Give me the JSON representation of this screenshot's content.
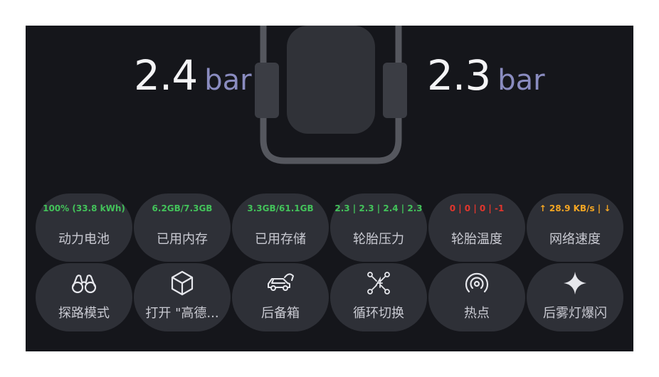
{
  "tire_pressure": {
    "front_left": {
      "value": "2.4",
      "unit": "bar"
    },
    "front_right": {
      "value": "2.3",
      "unit": "bar"
    }
  },
  "status_tiles": [
    {
      "value": "100% (33.8 kWh)",
      "label": "动力电池",
      "color": "#43c25a"
    },
    {
      "value": "6.2GB/7.3GB",
      "label": "已用内存",
      "color": "#43c25a"
    },
    {
      "value": "3.3GB/61.1GB",
      "label": "已用存储",
      "color": "#43c25a"
    },
    {
      "value": "2.3 | 2.3 | 2.4 | 2.3",
      "label": "轮胎压力",
      "color": "#43c25a"
    },
    {
      "value": "0 | 0 | 0 | -1",
      "label": "轮胎温度",
      "color": "#e2362d"
    },
    {
      "value": "↑ 28.9 KB/s | ↓",
      "label": "网络速度",
      "color": "#f5a623"
    }
  ],
  "action_tiles": [
    {
      "label": "探路模式",
      "icon": "binoculars-icon"
    },
    {
      "label": "打开 \"高德...",
      "icon": "cube-icon"
    },
    {
      "label": "后备箱",
      "icon": "car-trunk-icon"
    },
    {
      "label": "循环切换",
      "icon": "cycle-switch-icon"
    },
    {
      "label": "热点",
      "icon": "hotspot-icon"
    },
    {
      "label": "后雾灯爆闪",
      "icon": "sparkle-icon"
    }
  ]
}
